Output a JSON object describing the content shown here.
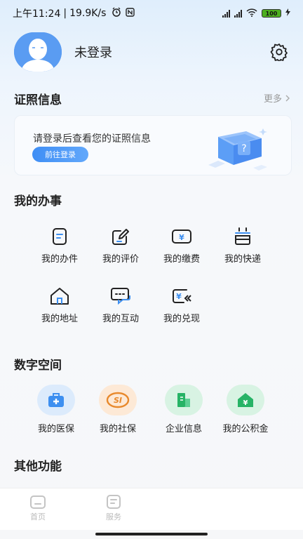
{
  "status_bar": {
    "time": "上午11:24",
    "speed": "19.9K/s",
    "battery": "100"
  },
  "profile": {
    "name": "未登录"
  },
  "certificate": {
    "title": "证照信息",
    "more": "更多",
    "prompt": "请登录后查看您的证照信息",
    "login_button": "前往登录"
  },
  "my_affairs": {
    "title": "我的办事",
    "items": [
      {
        "label": "我的办件",
        "icon": "document-icon"
      },
      {
        "label": "我的评价",
        "icon": "edit-icon"
      },
      {
        "label": "我的缴费",
        "icon": "payment-icon"
      },
      {
        "label": "我的快递",
        "icon": "express-box-icon"
      },
      {
        "label": "我的地址",
        "icon": "home-address-icon"
      },
      {
        "label": "我的互动",
        "icon": "chat-icon"
      },
      {
        "label": "我的兑现",
        "icon": "cash-redeem-icon"
      }
    ]
  },
  "digital_space": {
    "title": "数字空间",
    "items": [
      {
        "label": "我的医保",
        "icon": "medical-kit-icon",
        "color": "#3d8ff0",
        "bg": "#e1eefc"
      },
      {
        "label": "我的社保",
        "icon": "social-security-icon",
        "color": "#ea8a2a",
        "bg": "#fdeedc"
      },
      {
        "label": "企业信息",
        "icon": "enterprise-building-icon",
        "color": "#27b366",
        "bg": "#dcf4e6"
      },
      {
        "label": "我的公积金",
        "icon": "housing-fund-icon",
        "color": "#27b366",
        "bg": "#dcf4e6"
      }
    ]
  },
  "other": {
    "title": "其他功能"
  },
  "tabbar": {
    "tabs": [
      {
        "label": "首页",
        "icon": "home-tab-icon"
      },
      {
        "label": "服务",
        "icon": "service-tab-icon"
      }
    ]
  }
}
